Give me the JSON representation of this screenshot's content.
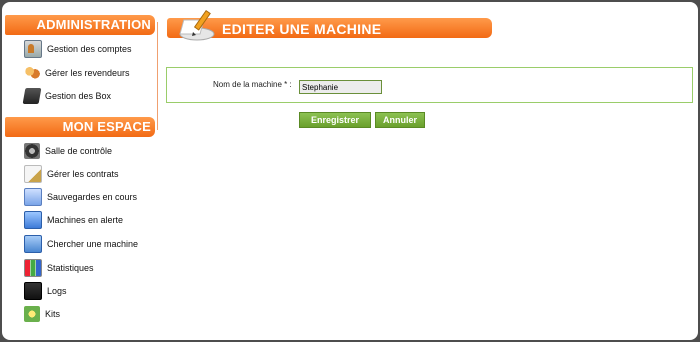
{
  "sidebar": {
    "administration": {
      "title": "ADMINISTRATION",
      "items": [
        {
          "label": "Gestion des comptes",
          "icon": "accounts-icon"
        },
        {
          "label": "Gérer les revendeurs",
          "icon": "resellers-icon"
        },
        {
          "label": "Gestion des Box",
          "icon": "box-icon"
        }
      ]
    },
    "mon_espace": {
      "title": "MON ESPACE",
      "items": [
        {
          "label": "Salle de contrôle",
          "icon": "control-room-icon"
        },
        {
          "label": "Gérer les contrats",
          "icon": "contracts-icon"
        },
        {
          "label": "Sauvegardes en cours",
          "icon": "backups-icon"
        },
        {
          "label": "Machines en alerte",
          "icon": "alert-machines-icon"
        },
        {
          "label": "Chercher une machine",
          "icon": "search-machine-icon"
        },
        {
          "label": "Statistiques",
          "icon": "statistics-icon"
        },
        {
          "label": "Logs",
          "icon": "logs-icon"
        },
        {
          "label": "Kits",
          "icon": "kits-icon"
        }
      ]
    }
  },
  "main": {
    "title": "EDITER UNE MACHINE",
    "form": {
      "machine_name_label": "Nom de la machine * :",
      "machine_name_value": "Stephanie"
    },
    "buttons": {
      "save": "Enregistrer",
      "cancel": "Annuler"
    }
  },
  "colors": {
    "accent_orange": "#f26a14",
    "accent_green": "#6aa02c",
    "background": "#ffffff"
  }
}
